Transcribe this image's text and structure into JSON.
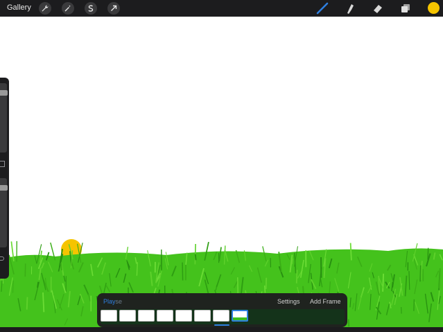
{
  "toolbar": {
    "gallery_label": "Gallery",
    "left_tools": [
      "wrench-icon",
      "magic-wand-icon",
      "selection-icon",
      "transform-arrow-icon"
    ],
    "right_tools": [
      "brush-icon",
      "smudge-icon",
      "eraser-icon",
      "layers-icon"
    ],
    "active_tool": "brush-icon",
    "accent_color": "#2f7fe0",
    "current_color": "#f5c400"
  },
  "sidebar": {
    "brush_size_level": 0.1,
    "opacity_level": 0.1
  },
  "canvas": {
    "background": "#ffffff",
    "grass_color": "#44c21c",
    "sun_color": "#f5c400"
  },
  "animation": {
    "play_label": "Play",
    "play_faded_suffix": "se",
    "settings_label": "Settings",
    "add_frame_label": "Add Frame",
    "frames": [
      {
        "label": ""
      },
      {
        "label": ""
      },
      {
        "label": ""
      },
      {
        "label": ""
      },
      {
        "label": ""
      },
      {
        "label": ""
      },
      {
        "label": ""
      },
      {
        "label": ""
      }
    ],
    "active_frame": 8,
    "frame_count": 8
  }
}
